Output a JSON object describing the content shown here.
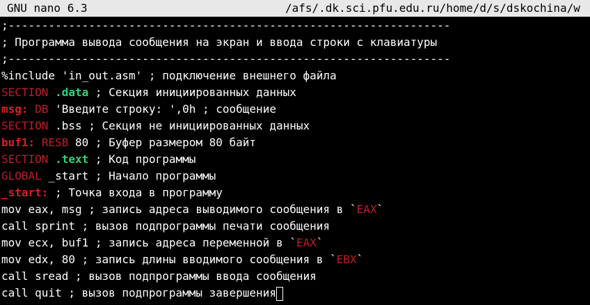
{
  "titlebar": {
    "app": "GNU nano 6.3",
    "path": "/afs/.dk.sci.pfu.edu.ru/home/d/s/dskochina/w"
  },
  "colors": {
    "background": "#000000",
    "titlebar_bg": "#e8e8e8",
    "text": "#ffffff",
    "keyword_red": "#c01c28",
    "section_name_green": "#33d17a",
    "label_red": "#e01b24"
  },
  "lines": [
    {
      "segments": [
        {
          "text": ";------------------------------------------------------------------",
          "style": "white"
        }
      ]
    },
    {
      "segments": [
        {
          "text": "; Программа вывода сообщения на экран и ввода строки с клавиатуры",
          "style": "white"
        }
      ]
    },
    {
      "segments": [
        {
          "text": ";------------------------------------------------------------------",
          "style": "white"
        }
      ]
    },
    {
      "segments": [
        {
          "text": "%include 'in_out.asm' ; подключение внешнего файла",
          "style": "white"
        }
      ]
    },
    {
      "segments": [
        {
          "text": "SECTION",
          "style": "red"
        },
        {
          "text": " ",
          "style": "white"
        },
        {
          "text": ".data",
          "style": "green"
        },
        {
          "text": " ; Секция инициированных данных",
          "style": "white"
        }
      ]
    },
    {
      "segments": [
        {
          "text": "msg:",
          "style": "label"
        },
        {
          "text": " ",
          "style": "white"
        },
        {
          "text": "DB",
          "style": "red"
        },
        {
          "text": " 'Введите строку: ',0h ; сообщение",
          "style": "white"
        }
      ]
    },
    {
      "segments": [
        {
          "text": "SECTION",
          "style": "red"
        },
        {
          "text": " .bss ; Секция не инициированных данных",
          "style": "white"
        }
      ]
    },
    {
      "segments": [
        {
          "text": "buf1:",
          "style": "label"
        },
        {
          "text": " ",
          "style": "white"
        },
        {
          "text": "RESB",
          "style": "red"
        },
        {
          "text": " 80 ; Буфер размером 80 байт",
          "style": "white"
        }
      ]
    },
    {
      "segments": [
        {
          "text": "SECTION",
          "style": "red"
        },
        {
          "text": " ",
          "style": "white"
        },
        {
          "text": ".text",
          "style": "green"
        },
        {
          "text": " ; Код программы",
          "style": "white"
        }
      ]
    },
    {
      "segments": [
        {
          "text": "GLOBAL",
          "style": "red"
        },
        {
          "text": " _start ; Начало программы",
          "style": "white"
        }
      ]
    },
    {
      "segments": [
        {
          "text": "_start:",
          "style": "label"
        },
        {
          "text": " ; Точка входа в программу",
          "style": "white"
        }
      ]
    },
    {
      "segments": [
        {
          "text": "mov eax, msg ; запись адреса выводимого сообщения в `",
          "style": "white"
        },
        {
          "text": "EAX",
          "style": "red"
        },
        {
          "text": "`",
          "style": "white"
        }
      ]
    },
    {
      "segments": [
        {
          "text": "call sprint ; вызов подпрограммы печати сообщения",
          "style": "white"
        }
      ]
    },
    {
      "segments": [
        {
          "text": "mov ecx, buf1 ; запись адреса переменной в `",
          "style": "white"
        },
        {
          "text": "EAX",
          "style": "red"
        },
        {
          "text": "`",
          "style": "white"
        }
      ]
    },
    {
      "segments": [
        {
          "text": "mov edx, 80 ; запись длины вводимого сообщения в `",
          "style": "white"
        },
        {
          "text": "EBX",
          "style": "red"
        },
        {
          "text": "`",
          "style": "white"
        }
      ]
    },
    {
      "segments": [
        {
          "text": "call sread ; вызов подпрограммы ввода сообщения",
          "style": "white"
        }
      ]
    },
    {
      "segments": [
        {
          "text": "call quit ; вызов подпрограммы завершения",
          "style": "white"
        }
      ],
      "cursor": true
    }
  ]
}
